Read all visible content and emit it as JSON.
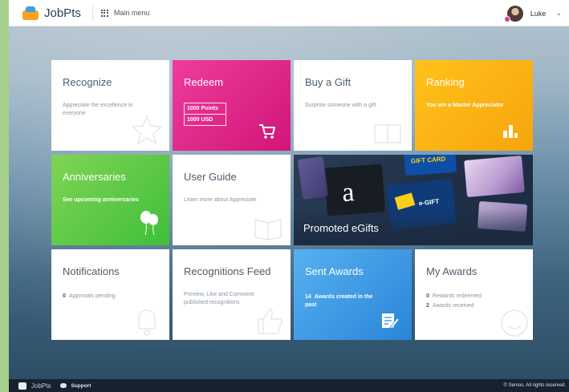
{
  "header": {
    "app_name": "JobPts",
    "main_menu_label": "Main menu",
    "user_name": "Luke",
    "chevron": "⌄"
  },
  "tiles": {
    "recognize": {
      "title": "Recognize",
      "desc": "Appreciate the excellence in everyone"
    },
    "redeem": {
      "title": "Redeem",
      "points": "1000 Points",
      "usd": "1000 USD"
    },
    "buy_gift": {
      "title": "Buy a Gift",
      "desc": "Surprise someone with a gift"
    },
    "ranking": {
      "title": "Ranking",
      "desc": "You are a Master Appreciator"
    },
    "anniversaries": {
      "title": "Anniversaries",
      "desc": "See upcoming anniversaries"
    },
    "user_guide": {
      "title": "User Guide",
      "desc": "Learn more about Appreciate"
    },
    "promoted": {
      "title": "Promoted eGifts"
    },
    "notifications": {
      "title": "Notifications",
      "count": "0",
      "count_label": "Approvals pending"
    },
    "feed": {
      "title": "Recognitions Feed",
      "desc": "Preview, Like and Comment published recognitions"
    },
    "sent_awards": {
      "title": "Sent Awards",
      "count": "14",
      "count_label": "Awards created in the past"
    },
    "my_awards": {
      "title": "My Awards",
      "redeemed_count": "0",
      "redeemed_label": "Rewards redeemed",
      "received_count": "2",
      "received_label": "Awards received"
    }
  },
  "footer": {
    "app_name": "JobPts",
    "support_label": "Support",
    "copyright": "© Semos. All rights reserved."
  },
  "colors": {
    "magenta": "#e0268a",
    "orange": "#fbb313",
    "green": "#5ccb47",
    "blue": "#3f9ae6"
  }
}
